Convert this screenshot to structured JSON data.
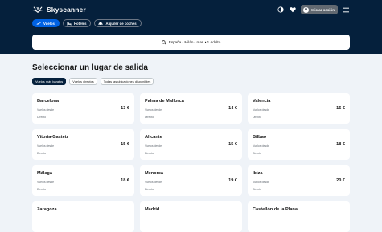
{
  "header": {
    "brand": "Skyscanner",
    "login_label": "Iniciar sesión",
    "icons": [
      "theme-icon",
      "heart-icon",
      "menu-icon"
    ],
    "colors": {
      "background": "#05203c",
      "accent": "#0062e3"
    }
  },
  "tabs": [
    {
      "label": "Vuelos",
      "icon": "plane-icon",
      "active": true
    },
    {
      "label": "Hoteles",
      "icon": "bed-icon",
      "active": false
    },
    {
      "label": "Alquiler de coches",
      "icon": "car-icon",
      "active": false
    }
  ],
  "search": {
    "summary": "España - Milán • mar. • 1 Adulto"
  },
  "page_title": "Seleccionar un lugar de salida",
  "filters": [
    {
      "label": "Vuelos más baratos",
      "active": true
    },
    {
      "label": "Vuelos directos",
      "active": false
    },
    {
      "label": "Todas las ubicaciones disponibles",
      "active": false
    }
  ],
  "destinations": [
    {
      "city": "Barcelona",
      "sub": "Vuelos desde",
      "price": "13 €",
      "direct": "Directo"
    },
    {
      "city": "Palma de Mallorca",
      "sub": "Vuelos desde",
      "price": "14 €",
      "direct": "Directo"
    },
    {
      "city": "Valencia",
      "sub": "Vuelos desde",
      "price": "15 €",
      "direct": "Directo"
    },
    {
      "city": "Vitoria-Gasteiz",
      "sub": "Vuelos desde",
      "price": "15 €",
      "direct": "Directo"
    },
    {
      "city": "Alicante",
      "sub": "Vuelos desde",
      "price": "15 €",
      "direct": "Directo"
    },
    {
      "city": "Bilbao",
      "sub": "Vuelos desde",
      "price": "18 €",
      "direct": "Directo"
    },
    {
      "city": "Málaga",
      "sub": "Vuelos desde",
      "price": "18 €",
      "direct": "Directo"
    },
    {
      "city": "Menorca",
      "sub": "Vuelos desde",
      "price": "19 €",
      "direct": "Directo"
    },
    {
      "city": "Ibiza",
      "sub": "Vuelos desde",
      "price": "20 €",
      "direct": "Directo"
    },
    {
      "city": "Zaragoza",
      "sub": "",
      "price": "",
      "direct": ""
    },
    {
      "city": "Madrid",
      "sub": "",
      "price": "",
      "direct": ""
    },
    {
      "city": "Castellón de la Plana",
      "sub": "",
      "price": "",
      "direct": ""
    }
  ]
}
